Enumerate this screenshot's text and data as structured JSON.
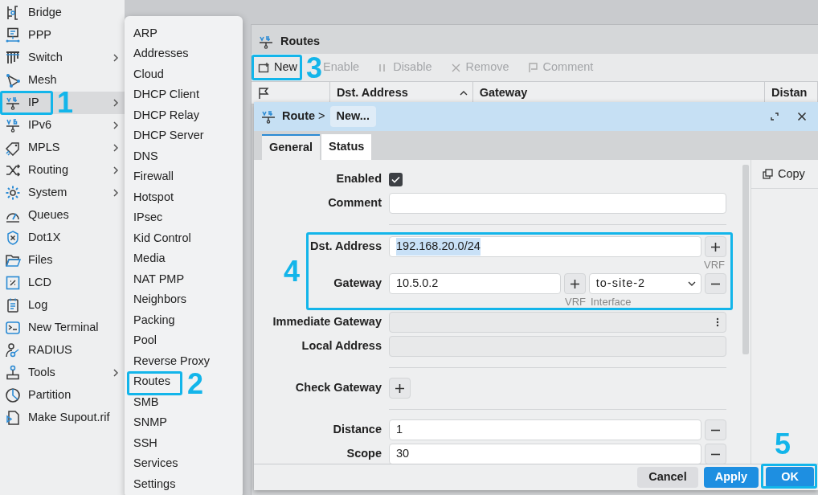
{
  "sidebar": {
    "items": [
      {
        "label": "Bridge",
        "submenu": false,
        "selected": false
      },
      {
        "label": "PPP",
        "submenu": false,
        "selected": false
      },
      {
        "label": "Switch",
        "submenu": true,
        "selected": false
      },
      {
        "label": "Mesh",
        "submenu": false,
        "selected": false
      },
      {
        "label": "IP",
        "submenu": true,
        "selected": true,
        "callout": "1"
      },
      {
        "label": "IPv6",
        "submenu": true,
        "selected": false
      },
      {
        "label": "MPLS",
        "submenu": true,
        "selected": false
      },
      {
        "label": "Routing",
        "submenu": true,
        "selected": false
      },
      {
        "label": "System",
        "submenu": true,
        "selected": false
      },
      {
        "label": "Queues",
        "submenu": false,
        "selected": false
      },
      {
        "label": "Dot1X",
        "submenu": false,
        "selected": false
      },
      {
        "label": "Files",
        "submenu": false,
        "selected": false
      },
      {
        "label": "LCD",
        "submenu": false,
        "selected": false
      },
      {
        "label": "Log",
        "submenu": false,
        "selected": false
      },
      {
        "label": "New Terminal",
        "submenu": false,
        "selected": false
      },
      {
        "label": "RADIUS",
        "submenu": false,
        "selected": false
      },
      {
        "label": "Tools",
        "submenu": true,
        "selected": false
      },
      {
        "label": "Partition",
        "submenu": false,
        "selected": false
      },
      {
        "label": "Make Supout.rif",
        "submenu": false,
        "selected": false
      }
    ]
  },
  "submenu": {
    "items": [
      {
        "label": "ARP"
      },
      {
        "label": "Addresses"
      },
      {
        "label": "Cloud"
      },
      {
        "label": "DHCP Client"
      },
      {
        "label": "DHCP Relay"
      },
      {
        "label": "DHCP Server"
      },
      {
        "label": "DNS"
      },
      {
        "label": "Firewall"
      },
      {
        "label": "Hotspot"
      },
      {
        "label": "IPsec"
      },
      {
        "label": "Kid Control"
      },
      {
        "label": "Media"
      },
      {
        "label": "NAT PMP"
      },
      {
        "label": "Neighbors"
      },
      {
        "label": "Packing"
      },
      {
        "label": "Pool"
      },
      {
        "label": "Reverse Proxy"
      },
      {
        "label": "Routes",
        "callout": "2"
      },
      {
        "label": "SMB"
      },
      {
        "label": "SNMP"
      },
      {
        "label": "SSH"
      },
      {
        "label": "Services"
      },
      {
        "label": "Settings"
      }
    ]
  },
  "routes_window": {
    "title": "Routes",
    "toolbar": [
      {
        "kind": "new",
        "label": "New",
        "disabled": false,
        "callout": "3"
      },
      {
        "kind": "enable",
        "label": "Enable",
        "disabled": true
      },
      {
        "kind": "disable",
        "label": "Disable",
        "disabled": true
      },
      {
        "kind": "remove",
        "label": "Remove",
        "disabled": true
      },
      {
        "kind": "comment",
        "label": "Comment",
        "disabled": true
      }
    ],
    "table": {
      "columns": [
        {
          "kind": "flag"
        },
        {
          "label": "Dst. Address",
          "sorted": true
        },
        {
          "label": "Gateway",
          "sorted": false
        },
        {
          "label": "Distan",
          "sorted": false
        }
      ]
    }
  },
  "dialog": {
    "breadcrumb": "Route",
    "separator": ">",
    "title": "New...",
    "tabs": [
      {
        "label": "General",
        "selected": true
      },
      {
        "label": "Status",
        "selected": false
      }
    ],
    "side_actions": [
      {
        "label": "Copy"
      }
    ],
    "form": [
      {
        "kind": "checkbox",
        "label": "Enabled",
        "checked": true
      },
      {
        "kind": "text",
        "label": "Comment"
      },
      {
        "kind": "divider"
      },
      {
        "kind": "group",
        "callout": "4",
        "children": [
          {
            "kind": "dst",
            "label": "Dst. Address",
            "value": "192.168.20.0/24",
            "text_selected": true,
            "caption": "VRF"
          },
          {
            "kind": "gateway",
            "label": "Gateway",
            "value": "10.5.0.2",
            "interface": "to-site-2",
            "captions": [
              "VRF",
              "Interface"
            ]
          }
        ]
      },
      {
        "kind": "readonly",
        "label": "Immediate Gateway",
        "menu": true
      },
      {
        "kind": "readonly",
        "label": "Local Address",
        "menu": false
      },
      {
        "kind": "divider"
      },
      {
        "kind": "add",
        "label": "Check Gateway"
      },
      {
        "kind": "divider"
      },
      {
        "kind": "number",
        "label": "Distance",
        "value": "1"
      },
      {
        "kind": "number",
        "label": "Scope",
        "value": "30"
      }
    ],
    "buttons": [
      {
        "kind": "secondary",
        "label": "Cancel"
      },
      {
        "kind": "primary",
        "label": "Apply"
      },
      {
        "kind": "primary",
        "label": "OK",
        "callout": "5"
      }
    ]
  }
}
